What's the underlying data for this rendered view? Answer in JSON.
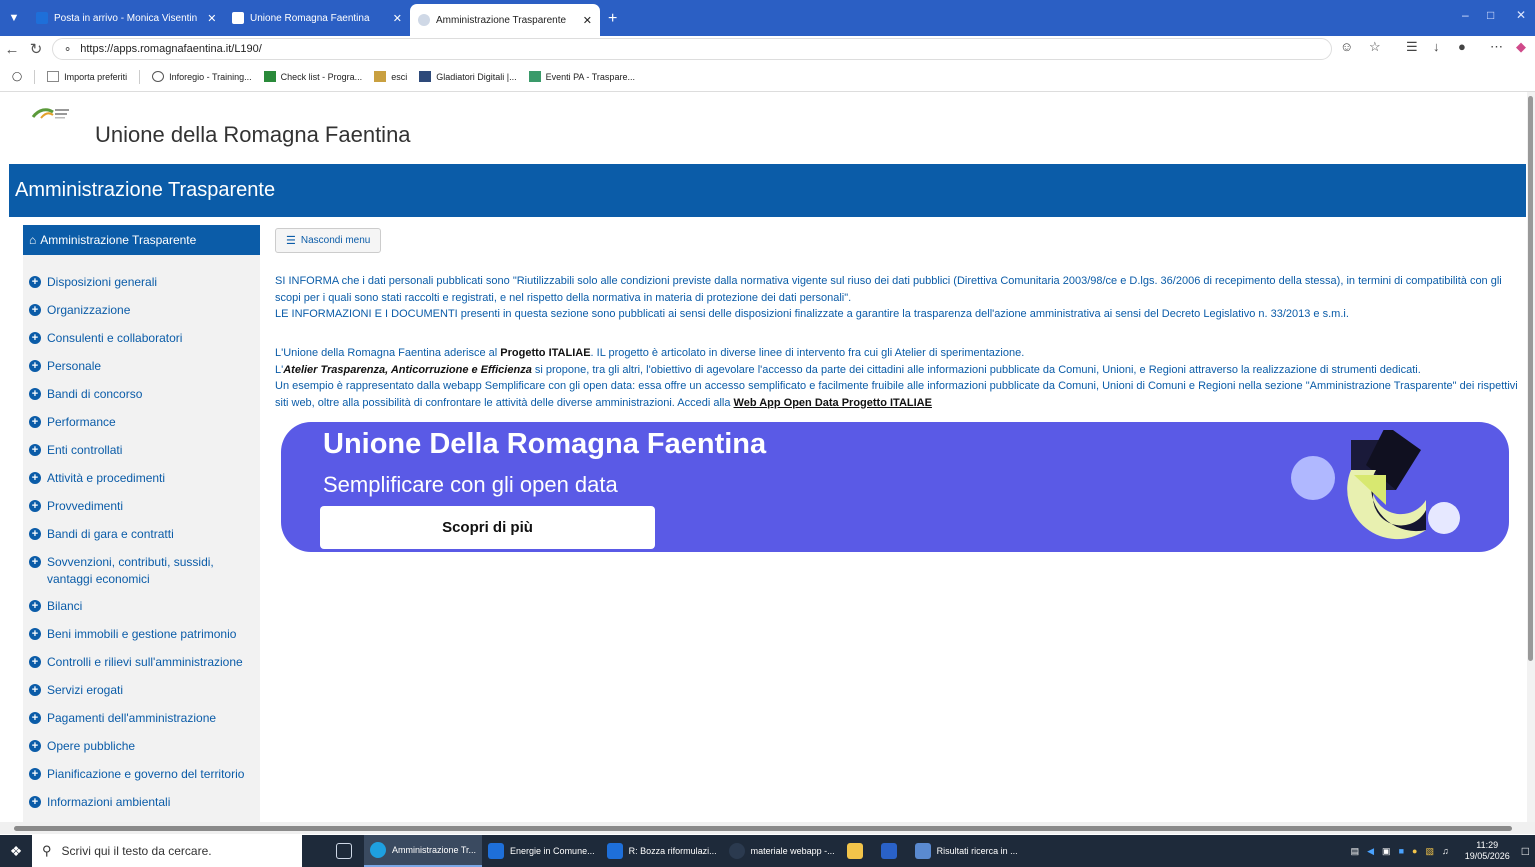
{
  "browser": {
    "tabs": [
      {
        "label": "Posta in arrivo - Monica Visentin",
        "color": "#1e6fd9",
        "active": false
      },
      {
        "label": "Unione Romagna Faentina",
        "color": "#ffffff",
        "active": false
      },
      {
        "label": "Amministrazione Trasparente",
        "color": "#cfd8e6",
        "active": true
      }
    ],
    "url": "https://apps.romagnafaentina.it/L190/",
    "bookmarks": [
      {
        "label": "Importa preferiti",
        "color": "#888888"
      },
      {
        "label": "Inforegio - Training...",
        "color": "#555555"
      },
      {
        "label": "Check list - Progra...",
        "color": "#2a8a3a"
      },
      {
        "label": "esci",
        "color": "#c9a040"
      },
      {
        "label": "Gladiatori Digitali |...",
        "color": "#2e4a7a"
      },
      {
        "label": "Eventi PA - Traspare...",
        "color": "#3a9a6a"
      }
    ]
  },
  "site": {
    "title": "Unione della Romagna Faentina",
    "section": "Amministrazione Trasparente",
    "accent": "#0b5ca8"
  },
  "sidebar": {
    "header": "Amministrazione Trasparente",
    "items": [
      {
        "label": "Disposizioni generali"
      },
      {
        "label": "Organizzazione"
      },
      {
        "label": "Consulenti e collaboratori"
      },
      {
        "label": "Personale"
      },
      {
        "label": "Bandi di concorso"
      },
      {
        "label": "Performance"
      },
      {
        "label": "Enti controllati"
      },
      {
        "label": "Attività e procedimenti"
      },
      {
        "label": "Provvedimenti"
      },
      {
        "label": "Bandi di gara e contratti"
      },
      {
        "label": "Sovvenzioni, contributi, sussidi, vantaggi economici"
      },
      {
        "label": "Bilanci"
      },
      {
        "label": "Beni immobili e gestione patrimonio"
      },
      {
        "label": "Controlli e rilievi sull'amministrazione"
      },
      {
        "label": "Servizi erogati"
      },
      {
        "label": "Pagamenti dell'amministrazione"
      },
      {
        "label": "Opere pubbliche"
      },
      {
        "label": "Pianificazione e governo del territorio"
      },
      {
        "label": "Informazioni ambientali"
      }
    ]
  },
  "main": {
    "hide_menu": "Nascondi menu",
    "p1": "SI INFORMA che i dati personali pubblicati sono \"Riutilizzabili solo alle condizioni previste dalla normativa vigente sul riuso dei dati pubblici (Direttiva Comunitaria 2003/98/ce e D.lgs. 36/2006 di recepimento della stessa), in termini di compatibilità con gli scopi per i quali sono stati raccolti e registrati, e nel rispetto della normativa in materia di protezione dei dati personali\".",
    "p2": "LE INFORMAZIONI E I DOCUMENTI presenti in questa sezione sono pubblicati ai sensi delle disposizioni finalizzate a garantire la trasparenza dell'azione amministrativa ai sensi del Decreto Legislativo n. 33/2013 e s.m.i.",
    "p3_a": "L'Unione della Romagna Faentina aderisce al ",
    "p3_b": "Progetto ITALIAE",
    "p3_c": ". IL progetto è articolato in diverse linee di intervento fra cui gli Atelier di sperimentazione.",
    "p4_a": "L'",
    "p4_b": "Atelier Trasparenza, Anticorruzione e Efficienza",
    "p4_c": " si propone, tra gli altri, l'obiettivo di agevolare l'accesso da parte dei cittadini alle informazioni pubblicate da Comuni, Unioni, e Regioni attraverso la realizzazione di strumenti dedicati.",
    "p5": "Un esempio è rappresentato dalla webapp Semplificare con gli open data: essa offre un accesso semplificato e facilmente fruibile alle informazioni pubblicate da Comuni, Unioni di Comuni e Regioni nella sezione \"Amministrazione Trasparente\" dei rispettivi siti web, oltre alla possibilità di confrontare le attività delle diverse amministrazioni. Accedi alla ",
    "p5_link": "Web App Open Data Progetto ITALIAE"
  },
  "banner": {
    "title": "Unione Della Romagna Faentina",
    "subtitle": "Semplificare con gli open data",
    "button": "Scopri di più",
    "bg": "#5a5ae6"
  },
  "taskbar": {
    "search_placeholder": "Scrivi qui il testo da cercare.",
    "apps": [
      {
        "label": "",
        "color": "#cfd8e6",
        "active": false
      },
      {
        "label": "Amministrazione Tr...",
        "color": "#1ea0e0",
        "active": true
      },
      {
        "label": "Energie in Comune...",
        "color": "#1e6fd9",
        "active": false
      },
      {
        "label": "R: Bozza riformulazi...",
        "color": "#1e6fd9",
        "active": false
      },
      {
        "label": "materiale webapp -...",
        "color": "#2b3a4f",
        "active": false
      },
      {
        "label": "",
        "color": "#f2c44a",
        "active": false
      },
      {
        "label": "",
        "color": "#2a62c8",
        "active": false
      },
      {
        "label": "Risultati ricerca in ...",
        "color": "#5a8ad0",
        "active": false
      }
    ],
    "time": "11:29",
    "date": "19/05/2026"
  }
}
